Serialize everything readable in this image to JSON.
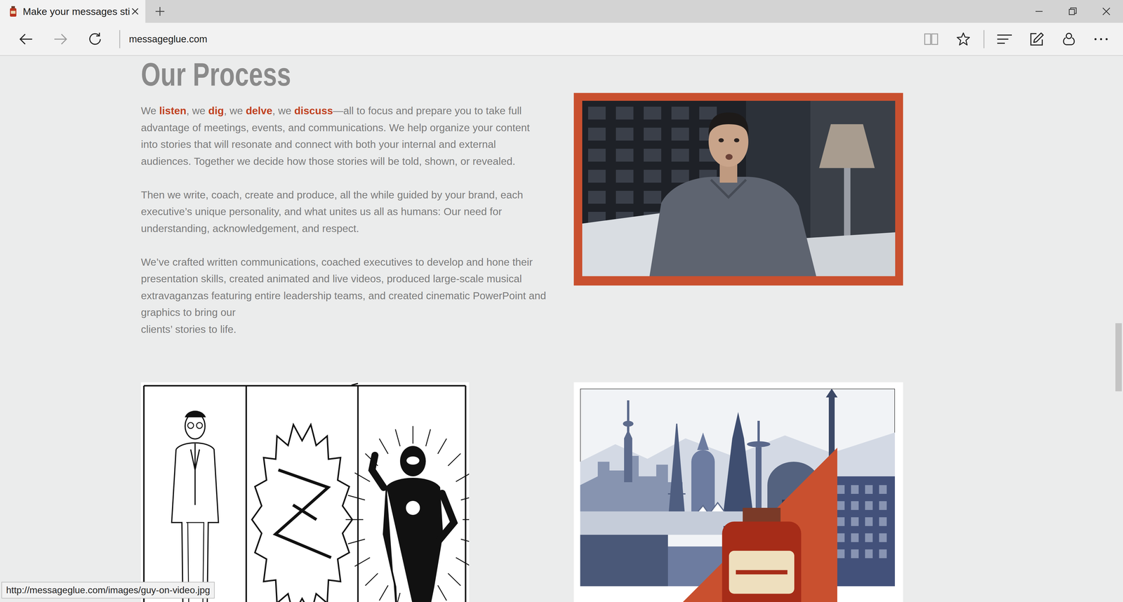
{
  "browser": {
    "tab": {
      "title": "Make your messages sti",
      "selected": true
    },
    "address": "messageglue.com",
    "forward_enabled": false
  },
  "page": {
    "heading": "Our Process",
    "paragraphs": [
      {
        "lines": [
          [
            {
              "text": "We ",
              "strong": false
            },
            {
              "text": "listen",
              "strong": true
            },
            {
              "text": ", we ",
              "strong": false
            },
            {
              "text": "dig",
              "strong": true
            },
            {
              "text": ", we ",
              "strong": false
            },
            {
              "text": "delve",
              "strong": true
            },
            {
              "text": ", we ",
              "strong": false
            },
            {
              "text": "discuss",
              "strong": true
            },
            {
              "text": "—all to focus and prepare you to take full advantage of meetings, events, and communications. We help organize your content into stories that will resonate and connect with both your internal and external audiences. Together we decide how those stories will be told, shown, or revealed.",
              "strong": false
            }
          ]
        ]
      },
      {
        "lines": [
          [
            {
              "text": "Then we write, coach, create and produce, all the while guided by your brand, each executive’s unique personality, and what unites us all as humans: Our need for understanding, acknowledgement, and respect.",
              "strong": false
            }
          ]
        ]
      },
      {
        "lines": [
          [
            {
              "text": "We’ve crafted written communications, coached executives to develop and hone their presentation skills, created animated and live videos, produced large-scale musical extravaganzas featuring entire leadership teams, and created cinematic PowerPoint and graphics to bring our",
              "strong": false
            }
          ],
          [
            {
              "text": "clients’ stories to life.",
              "strong": false
            }
          ]
        ]
      }
    ]
  },
  "scrollbar": {
    "offset": 0.49,
    "level": 0.125
  },
  "status_url": "http://messageglue.com/images/guy-on-video.jpg"
}
